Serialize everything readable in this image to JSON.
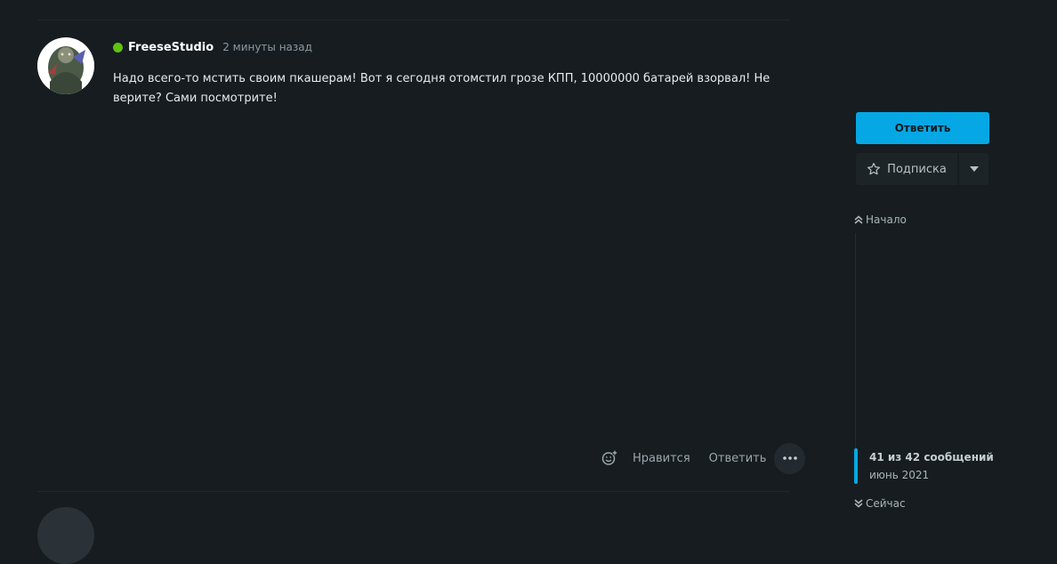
{
  "post": {
    "username": "FreeseStudio",
    "timestamp": "2 минуты назад",
    "body": "Надо всего-то мстить своим пкашерам! Вот я сегодня отомстил грозе КПП, 10000000 батарей взорвал! Не верите? Сами посмотрите!",
    "online_color": "#60c20f",
    "actions": {
      "react_icon": "smile-plus-icon",
      "like_label": "Нравится",
      "reply_label": "Ответить",
      "more_icon": "more-dots-icon"
    }
  },
  "sidebar": {
    "reply_button_label": "Ответить",
    "subscribe_label": "Подписка",
    "subscribe_icon": "star-outline-icon",
    "dropdown_icon": "caret-down-icon",
    "accent_color": "#05a8e4"
  },
  "timeline": {
    "start_label": "Начало",
    "position_label": "41 из 42 сообщений",
    "date_label": "июнь 2021",
    "now_label": "Сейчас",
    "current_post": 41,
    "total_posts": 42
  }
}
